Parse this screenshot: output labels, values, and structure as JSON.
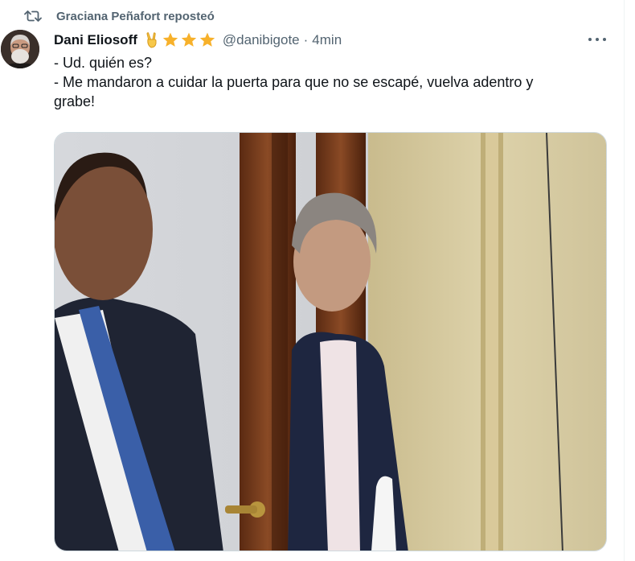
{
  "repost": {
    "text": "Graciana Peñafort reposteó",
    "icon": "repost-icon"
  },
  "tweet": {
    "author_name": "Dani Eliosoff",
    "handle": "@danibigote",
    "separator": "·",
    "time": "4min",
    "badges": [
      "victory-hand-emoji",
      "star-emoji",
      "star-emoji",
      "star-emoji"
    ],
    "lines": [
      "- Ud. quién es?",
      "- Me mandaron a cuidar la puerta para que no se escapé, vuelva adentro y",
      "grabe!"
    ],
    "more_icon": "more-options-icon",
    "media_description_icon": "photo"
  },
  "colors": {
    "primary_text": "#0f1419",
    "secondary_text": "#536471",
    "star": "#f7b12b"
  }
}
